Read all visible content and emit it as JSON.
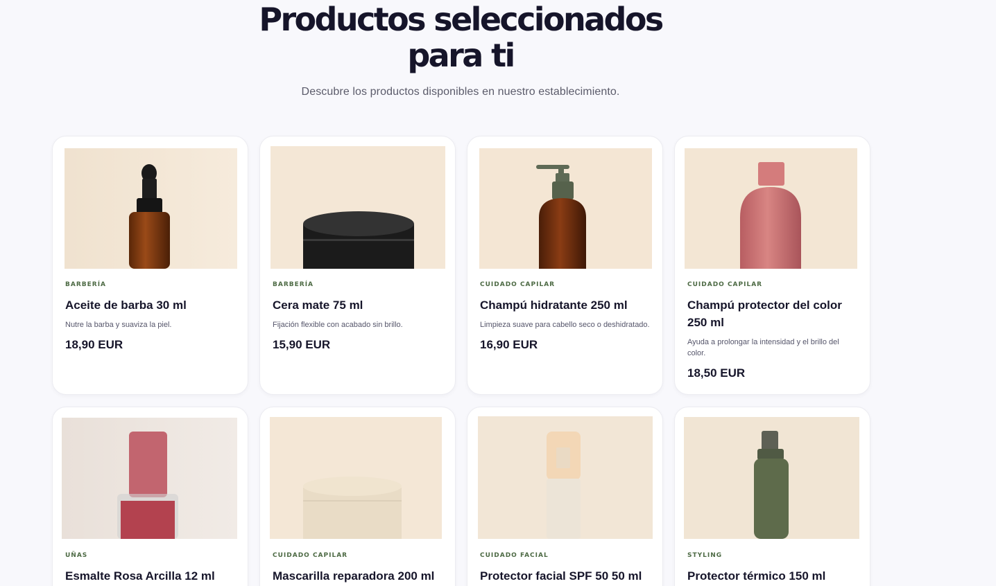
{
  "header": {
    "title_line1": "Productos seleccionados",
    "title_line2": "para ti",
    "subtitle": "Descubre los productos disponibles en nuestro establecimiento."
  },
  "products": [
    {
      "category": "BARBERÍA",
      "name": "Aceite de barba 30 ml",
      "description": "Nutre la barba y suaviza la piel.",
      "price": "18,90 EUR",
      "icon": "dropper-bottle-icon"
    },
    {
      "category": "BARBERÍA",
      "name": "Cera mate 75 ml",
      "description": "Fijación flexible con acabado sin brillo.",
      "price": "15,90 EUR",
      "icon": "tin-jar-icon"
    },
    {
      "category": "CUIDADO CAPILAR",
      "name": "Champú hidratante 250 ml",
      "description": "Limpieza suave para cabello seco o deshidratado.",
      "price": "16,90 EUR",
      "icon": "pump-bottle-icon"
    },
    {
      "category": "CUIDADO CAPILAR",
      "name": "Champú protector del color 250 ml",
      "description": "Ayuda a prolongar la intensidad y el brillo del color.",
      "price": "18,50 EUR",
      "icon": "flip-cap-bottle-icon"
    },
    {
      "category": "UÑAS",
      "name": "Esmalte Rosa Arcilla 12 ml",
      "description": "",
      "price": "",
      "icon": "nail-polish-icon"
    },
    {
      "category": "CUIDADO CAPILAR",
      "name": "Mascarilla reparadora 200 ml",
      "description": "",
      "price": "",
      "icon": "cream-jar-icon"
    },
    {
      "category": "CUIDADO FACIAL",
      "name": "Protector facial SPF 50 50 ml",
      "description": "",
      "price": "",
      "icon": "airless-pump-icon"
    },
    {
      "category": "STYLING",
      "name": "Protector térmico 150 ml",
      "description": "",
      "price": "",
      "icon": "spray-bottle-icon"
    }
  ]
}
